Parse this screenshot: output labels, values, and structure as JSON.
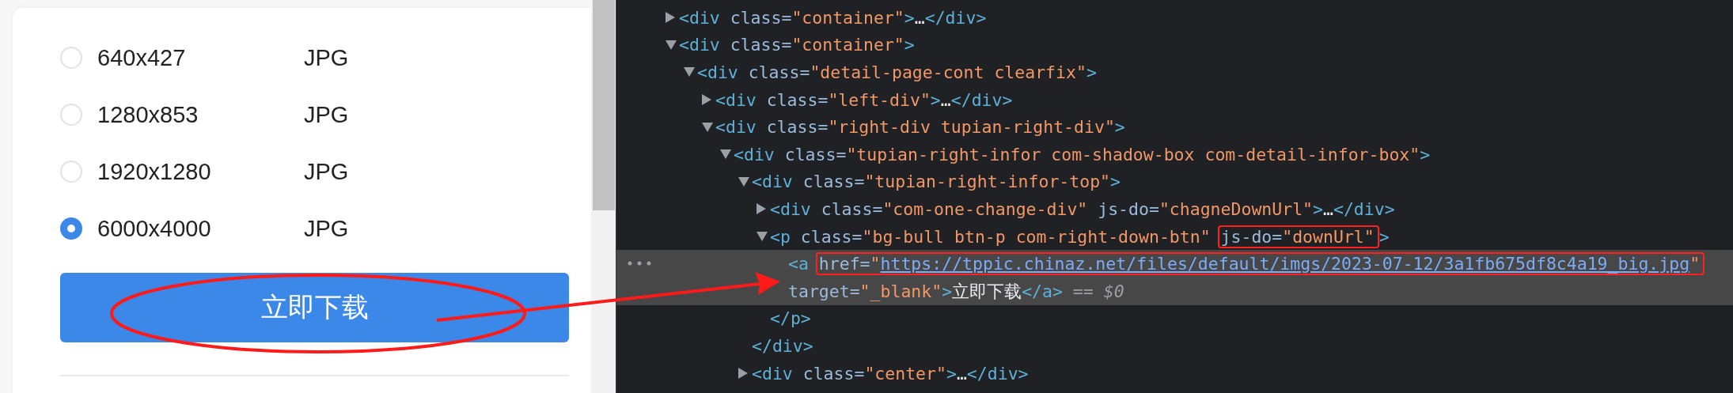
{
  "sizes": [
    {
      "resolution": "640x427",
      "format": "JPG",
      "selected": false
    },
    {
      "resolution": "1280x853",
      "format": "JPG",
      "selected": false
    },
    {
      "resolution": "1920x1280",
      "format": "JPG",
      "selected": false
    },
    {
      "resolution": "6000x4000",
      "format": "JPG",
      "selected": true
    }
  ],
  "download_button": "立即下载",
  "callout_ellipse": true,
  "callout_arrow": true,
  "dom_tree": [
    {
      "expanded": false,
      "selected": false,
      "lines": [
        [
          {
            "boxed": false,
            "tokens": [
              {
                "kind": "tag",
                "text": "<div"
              },
              {
                "kind": "attr",
                "text": " class="
              },
              {
                "kind": "value",
                "text": "\"container\""
              },
              {
                "kind": "tag",
                "text": ">"
              },
              {
                "kind": "text",
                "text": "…"
              },
              {
                "kind": "tag",
                "text": "</div>"
              }
            ]
          }
        ]
      ]
    },
    {
      "expanded": true,
      "selected": false,
      "lines": [
        [
          {
            "boxed": false,
            "tokens": [
              {
                "kind": "tag",
                "text": "<div"
              },
              {
                "kind": "attr",
                "text": " class="
              },
              {
                "kind": "value",
                "text": "\"container\""
              },
              {
                "kind": "tag",
                "text": ">"
              }
            ]
          }
        ]
      ],
      "children": [
        {
          "expanded": true,
          "selected": false,
          "lines": [
            [
              {
                "boxed": false,
                "tokens": [
                  {
                    "kind": "tag",
                    "text": "<div"
                  },
                  {
                    "kind": "attr",
                    "text": " class="
                  },
                  {
                    "kind": "value",
                    "text": "\"detail-page-cont clearfix\""
                  },
                  {
                    "kind": "tag",
                    "text": ">"
                  }
                ]
              }
            ]
          ],
          "children": [
            {
              "expanded": false,
              "selected": false,
              "lines": [
                [
                  {
                    "boxed": false,
                    "tokens": [
                      {
                        "kind": "tag",
                        "text": "<div"
                      },
                      {
                        "kind": "attr",
                        "text": " class="
                      },
                      {
                        "kind": "value",
                        "text": "\"left-div\""
                      },
                      {
                        "kind": "tag",
                        "text": ">"
                      },
                      {
                        "kind": "text",
                        "text": "…"
                      },
                      {
                        "kind": "tag",
                        "text": "</div>"
                      }
                    ]
                  }
                ]
              ]
            },
            {
              "expanded": true,
              "selected": false,
              "lines": [
                [
                  {
                    "boxed": false,
                    "tokens": [
                      {
                        "kind": "tag",
                        "text": "<div"
                      },
                      {
                        "kind": "attr",
                        "text": " class="
                      },
                      {
                        "kind": "value",
                        "text": "\"right-div tupian-right-div\""
                      },
                      {
                        "kind": "tag",
                        "text": ">"
                      }
                    ]
                  }
                ]
              ],
              "children": [
                {
                  "expanded": true,
                  "selected": false,
                  "lines": [
                    [
                      {
                        "boxed": false,
                        "tokens": [
                          {
                            "kind": "tag",
                            "text": "<div"
                          },
                          {
                            "kind": "attr",
                            "text": " class="
                          },
                          {
                            "kind": "value",
                            "text": "\"tupian-right-infor com-shadow-box com-detail-infor-box\""
                          },
                          {
                            "kind": "tag",
                            "text": ">"
                          }
                        ]
                      }
                    ]
                  ],
                  "children": [
                    {
                      "expanded": true,
                      "selected": false,
                      "lines": [
                        [
                          {
                            "boxed": false,
                            "tokens": [
                              {
                                "kind": "tag",
                                "text": "<div"
                              },
                              {
                                "kind": "attr",
                                "text": " class="
                              },
                              {
                                "kind": "value",
                                "text": "\"tupian-right-infor-top\""
                              },
                              {
                                "kind": "tag",
                                "text": ">"
                              }
                            ]
                          }
                        ]
                      ],
                      "children": [
                        {
                          "expanded": false,
                          "selected": false,
                          "lines": [
                            [
                              {
                                "boxed": false,
                                "tokens": [
                                  {
                                    "kind": "tag",
                                    "text": "<div"
                                  },
                                  {
                                    "kind": "attr",
                                    "text": " class="
                                  },
                                  {
                                    "kind": "value",
                                    "text": "\"com-one-change-div\""
                                  },
                                  {
                                    "kind": "attr",
                                    "text": " js-do="
                                  },
                                  {
                                    "kind": "value",
                                    "text": "\"chagneDownUrl\""
                                  },
                                  {
                                    "kind": "tag",
                                    "text": ">"
                                  },
                                  {
                                    "kind": "text",
                                    "text": "…"
                                  },
                                  {
                                    "kind": "tag",
                                    "text": "</div>"
                                  }
                                ]
                              }
                            ]
                          ]
                        },
                        {
                          "expanded": true,
                          "selected": false,
                          "lines": [
                            [
                              {
                                "boxed": false,
                                "tokens": [
                                  {
                                    "kind": "tag",
                                    "text": "<p"
                                  },
                                  {
                                    "kind": "attr",
                                    "text": " class="
                                  },
                                  {
                                    "kind": "value",
                                    "text": "\"bg-bull btn-p com-right-down-btn\" "
                                  }
                                ]
                              },
                              {
                                "boxed": true,
                                "tokens": [
                                  {
                                    "kind": "attr",
                                    "text": "js-do="
                                  },
                                  {
                                    "kind": "value",
                                    "text": "\"downUrl\""
                                  }
                                ]
                              },
                              {
                                "boxed": false,
                                "tokens": [
                                  {
                                    "kind": "tag",
                                    "text": ">"
                                  }
                                ]
                              }
                            ]
                          ],
                          "children": [
                            {
                              "selected": true,
                              "lines": [
                                [
                                  {
                                    "boxed": false,
                                    "tokens": [
                                      {
                                        "kind": "tag",
                                        "text": "<a "
                                      }
                                    ]
                                  },
                                  {
                                    "boxed": true,
                                    "tokens": [
                                      {
                                        "kind": "attr",
                                        "text": "href="
                                      },
                                      {
                                        "kind": "value",
                                        "text": "\""
                                      },
                                      {
                                        "kind": "link",
                                        "text": "https://tppic.chinaz.net/files/default/imgs/2023-07-12/3a1fb675df8c4a19_big.jpg"
                                      },
                                      {
                                        "kind": "value",
                                        "text": "\""
                                      }
                                    ]
                                  }
                                ],
                                [
                                  {
                                    "boxed": false,
                                    "tokens": [
                                      {
                                        "kind": "attr",
                                        "text": "target="
                                      },
                                      {
                                        "kind": "value",
                                        "text": "\"_blank\""
                                      },
                                      {
                                        "kind": "tag",
                                        "text": ">"
                                      },
                                      {
                                        "kind": "text",
                                        "text": "立即下载"
                                      },
                                      {
                                        "kind": "tag",
                                        "text": "</a>"
                                      },
                                      {
                                        "kind": "hint",
                                        "text": " == $0"
                                      }
                                    ]
                                  }
                                ]
                              ]
                            }
                          ],
                          "closing": [
                            {
                              "kind": "tag",
                              "text": "</p>"
                            }
                          ]
                        }
                      ],
                      "closing": [
                        {
                          "kind": "tag",
                          "text": "</div>"
                        }
                      ]
                    },
                    {
                      "expanded": false,
                      "selected": false,
                      "lines": [
                        [
                          {
                            "boxed": false,
                            "tokens": [
                              {
                                "kind": "tag",
                                "text": "<div"
                              },
                              {
                                "kind": "attr",
                                "text": " class="
                              },
                              {
                                "kind": "value",
                                "text": "\"center\""
                              },
                              {
                                "kind": "tag",
                                "text": ">"
                              },
                              {
                                "kind": "text",
                                "text": "…"
                              },
                              {
                                "kind": "tag",
                                "text": "</div>"
                              }
                            ]
                          }
                        ]
                      ]
                    }
                  ]
                }
              ]
            }
          ]
        }
      ]
    }
  ]
}
